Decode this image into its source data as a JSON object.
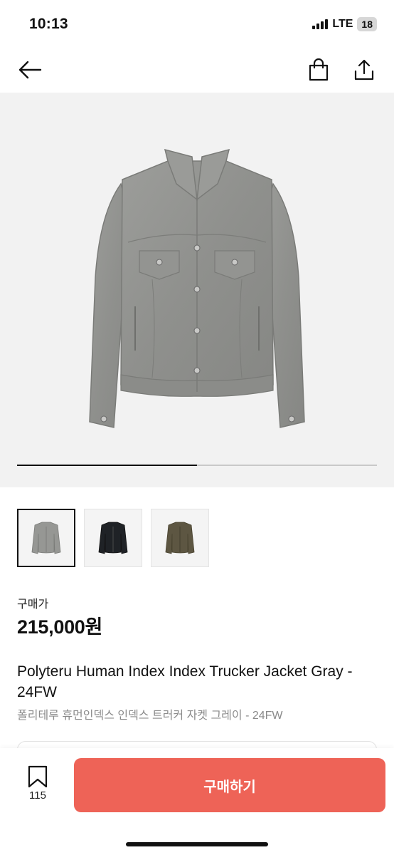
{
  "status_bar": {
    "time": "10:13",
    "network": "LTE",
    "battery": "18"
  },
  "nav": {
    "icons": [
      "back-arrow-icon",
      "shopping-bag-icon",
      "share-icon"
    ]
  },
  "gallery": {
    "progress": 0.5,
    "thumbnails": [
      {
        "color": "gray",
        "selected": true
      },
      {
        "color": "black",
        "selected": false
      },
      {
        "color": "khaki",
        "selected": false
      }
    ]
  },
  "product": {
    "price_label": "구매가",
    "price": "215,000원",
    "title_en": "Polyteru Human Index Index Trucker Jacket Gray - 24FW",
    "title_ko": "폴리테루 휴먼인덱스 인덱스 트러커 자켓 그레이 - 24FW"
  },
  "bottom": {
    "bookmark_count": "115",
    "buy_label": "구매하기",
    "buy_color": "#ee6357"
  }
}
